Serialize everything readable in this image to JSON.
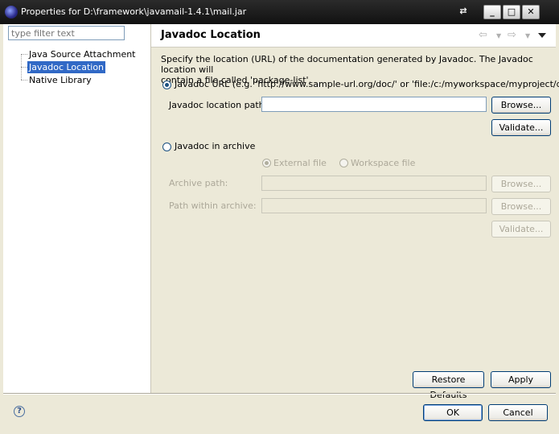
{
  "window": {
    "title": "Properties for D:\\framework\\javamail-1.4.1\\mail.jar"
  },
  "filter": {
    "placeholder": "type filter text"
  },
  "tree": {
    "items": [
      {
        "label": "Java Source Attachment",
        "selected": false
      },
      {
        "label": "Javadoc Location",
        "selected": true
      },
      {
        "label": "Native Library",
        "selected": false
      }
    ]
  },
  "page": {
    "title": "Javadoc Location",
    "nav": {
      "back_icon": "back-arrow-icon",
      "forward_icon": "forward-arrow-icon",
      "menu_icon": "view-menu-icon"
    },
    "description_line1": "Specify the location (URL) of the documentation generated by Javadoc. The Javadoc location will",
    "description_line2": "contain a file called 'package-list'.",
    "url_option": {
      "label": "Javadoc URL (e.g. 'http://www.sample-url.org/doc/' or 'file:/c:/myworkspace/myproject/doc')",
      "checked": true,
      "path_label": "Javadoc location path:",
      "path_value": "",
      "browse_label": "Browse...",
      "validate_label": "Validate..."
    },
    "archive_option": {
      "label": "Javadoc in archive",
      "checked": false,
      "external_file_label": "External file",
      "workspace_file_label": "Workspace file",
      "archive_path_label": "Archive path:",
      "archive_path_value": "",
      "path_within_label": "Path within archive:",
      "path_within_value": "",
      "browse_label": "Browse...",
      "validate_label": "Validate..."
    },
    "restore_defaults_label": "Restore Defaults",
    "apply_label": "Apply"
  },
  "footer": {
    "help_icon": "help-icon",
    "ok_label": "OK",
    "cancel_label": "Cancel"
  }
}
